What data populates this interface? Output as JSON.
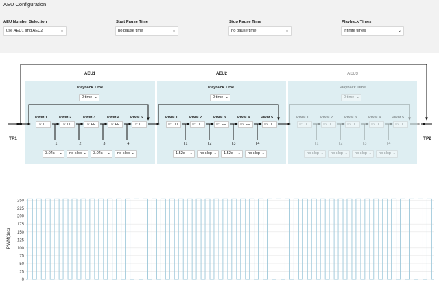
{
  "config": {
    "title": "AEU Configuration",
    "fields": [
      {
        "label": "AEU Number Selection",
        "value": "use AEU1 and AEU2"
      },
      {
        "label": "Start Pause Time",
        "value": "no pause time"
      },
      {
        "label": "Stop Pause Time",
        "value": "no pause time"
      },
      {
        "label": "Playback Times",
        "value": "infinite times"
      }
    ]
  },
  "diagram": {
    "tp1": "TP1",
    "tp2": "TP2",
    "pwm_prefix": "0x",
    "aeus": [
      {
        "name": "AEU1",
        "playback_label": "Playback Time",
        "playback_value": "0 time",
        "pwm": [
          {
            "label": "PWM 1",
            "value": "0"
          },
          {
            "label": "PWM 2",
            "value": "00"
          },
          {
            "label": "PWM 3",
            "value": "FF"
          },
          {
            "label": "PWM 4",
            "value": "FF"
          },
          {
            "label": "PWM 5",
            "value": "0"
          }
        ],
        "t": [
          {
            "label": "T1",
            "value": "3.04s"
          },
          {
            "label": "T2",
            "value": "no slop"
          },
          {
            "label": "T3",
            "value": "3.04s"
          },
          {
            "label": "T4",
            "value": "no slop"
          }
        ]
      },
      {
        "name": "AEU2",
        "playback_label": "Playback Time",
        "playback_value": "0 time",
        "pwm": [
          {
            "label": "PWM 1",
            "value": "00"
          },
          {
            "label": "PWM 2",
            "value": "0"
          },
          {
            "label": "PWM 3",
            "value": "FF"
          },
          {
            "label": "PWM 4",
            "value": "FF"
          },
          {
            "label": "PWM 5",
            "value": "0"
          }
        ],
        "t": [
          {
            "label": "T1",
            "value": "1.52s"
          },
          {
            "label": "T2",
            "value": "no slop"
          },
          {
            "label": "T3",
            "value": "1.52s"
          },
          {
            "label": "T4",
            "value": "no slop"
          }
        ]
      },
      {
        "name": "AEU3",
        "playback_label": "Playback Time",
        "playback_value": "0 time",
        "pwm": [
          {
            "label": "PWM 1",
            "value": "0"
          },
          {
            "label": "PWM 2",
            "value": "0"
          },
          {
            "label": "PWM 3",
            "value": "0"
          },
          {
            "label": "PWM 4",
            "value": "0"
          },
          {
            "label": "PWM 5",
            "value": "0"
          }
        ],
        "t": [
          {
            "label": "T1",
            "value": "no slop"
          },
          {
            "label": "T2",
            "value": "no slop"
          },
          {
            "label": "T3",
            "value": "no slop"
          },
          {
            "label": "T4",
            "value": "no slop"
          }
        ]
      }
    ]
  },
  "chart_data": {
    "type": "line",
    "ylabel": "PWM(dec)",
    "yticks": [
      0,
      25,
      50,
      75,
      100,
      125,
      150,
      175,
      200,
      225,
      250
    ],
    "ylim": [
      0,
      260
    ],
    "grid": true,
    "series": [
      {
        "high": 255,
        "low": 0,
        "pulses": 46
      }
    ],
    "color": "#9cc7d9"
  },
  "colors": {
    "panel": "#deeef2",
    "config_bg": "#f2f2f2",
    "line": "#111111"
  }
}
